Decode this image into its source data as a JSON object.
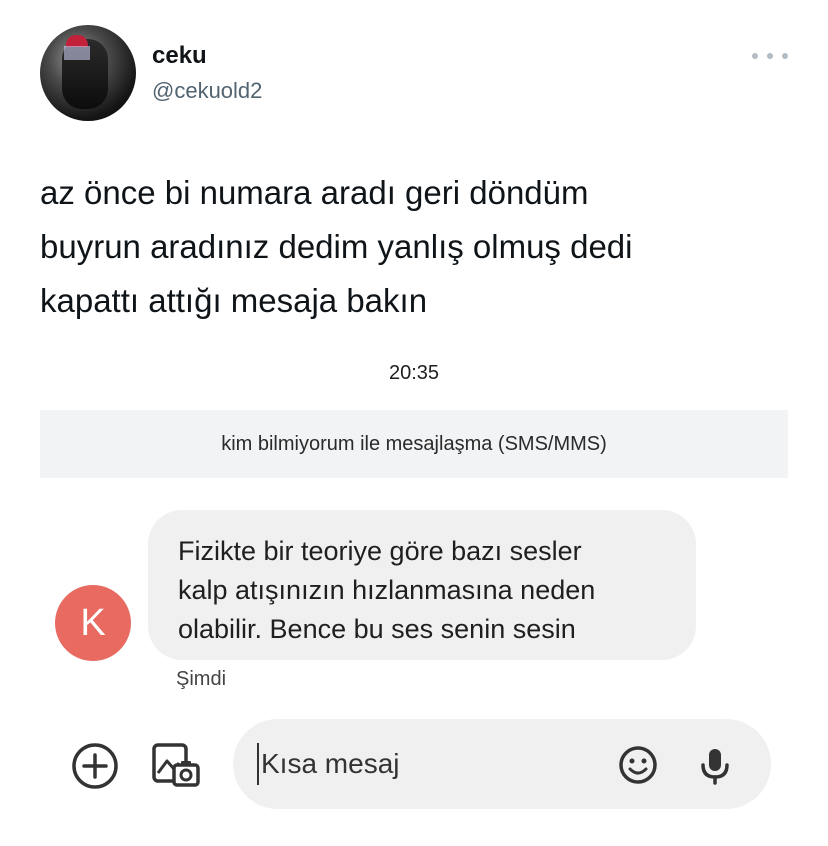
{
  "tweet": {
    "author_name": "ceku",
    "author_handle": "@cekuold2",
    "text": "az önce bi numara aradı geri döndüm\nbuyrun aradınız dedim yanlış olmuş dedi\nkapattı attığı mesaja bakın"
  },
  "sms": {
    "time": "20:35",
    "banner": "kim bilmiyorum  ile mesajlaşma (SMS/MMS)",
    "contact_initial": "K",
    "message": "Fizikte bir teoriye göre bazı sesler\nkalp atışınızın hızlanmasına neden\nolabilir. Bence bu ses senin sesin",
    "status": "Şimdi",
    "composer_placeholder": "Kısa mesaj"
  },
  "icons": {
    "more": "more-dots-icon",
    "add": "plus-circle-icon",
    "gallery": "gallery-camera-icon",
    "emoji": "emoji-icon",
    "mic": "microphone-icon"
  },
  "colors": {
    "contact_avatar": "#e86a61",
    "bubble": "#f0f0f0",
    "banner": "#f2f3f5",
    "handle": "#536471"
  }
}
